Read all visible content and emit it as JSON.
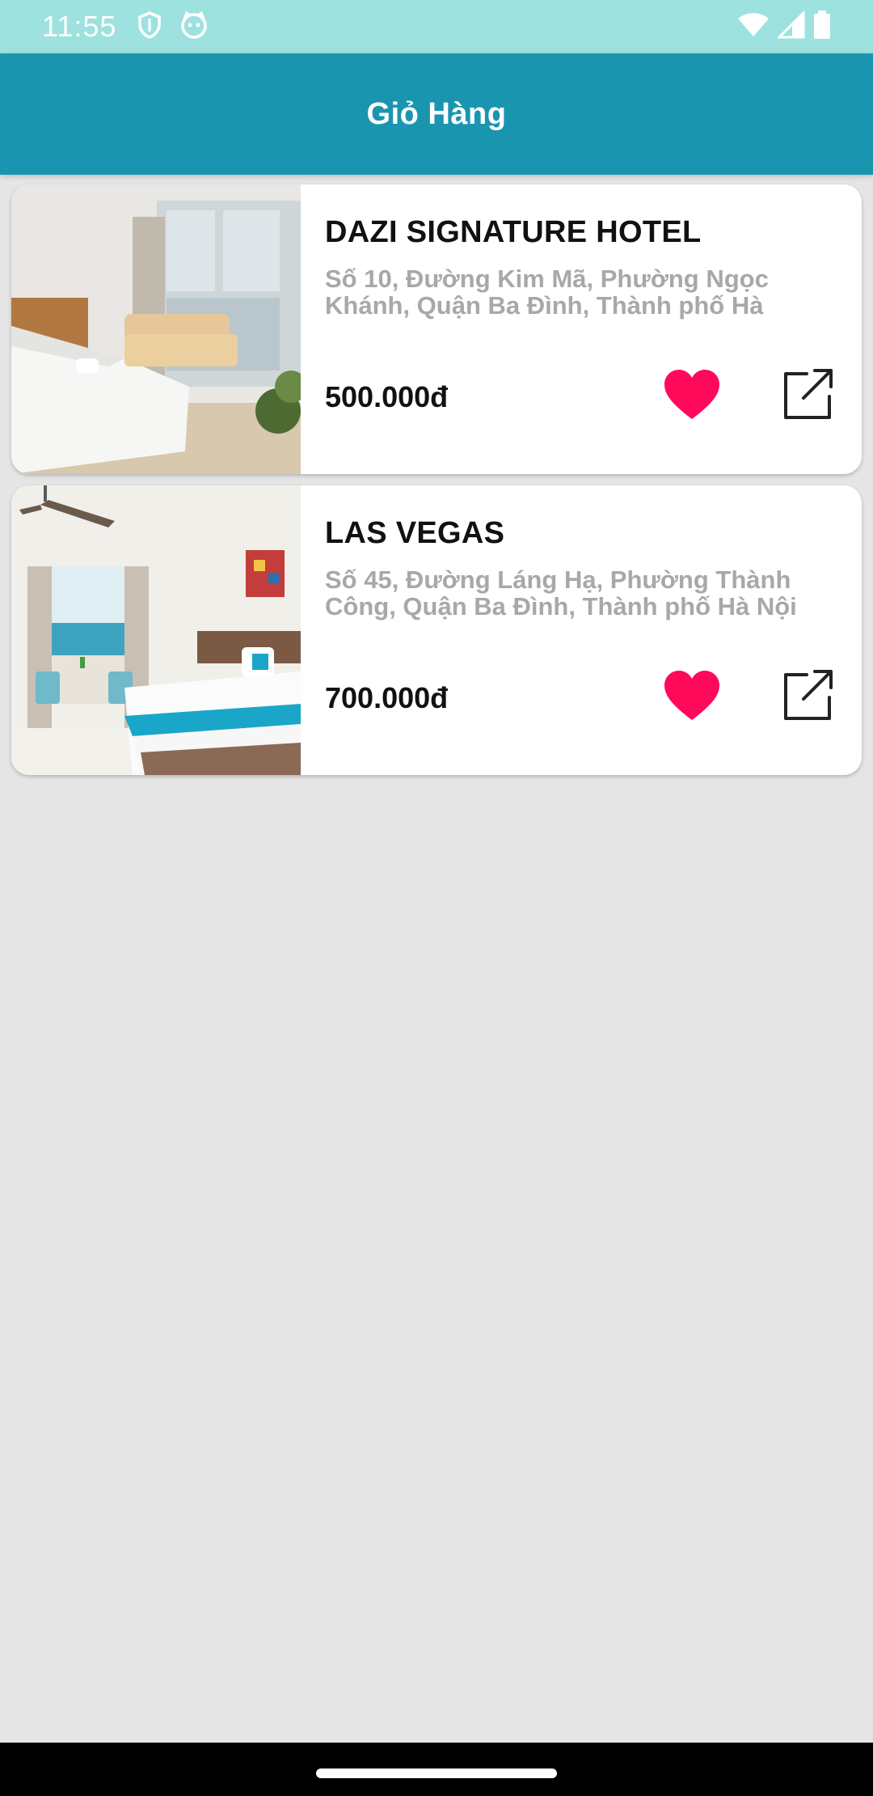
{
  "status_bar": {
    "time": "11:55",
    "icons": [
      "shield-icon",
      "cat-icon",
      "wifi-icon",
      "signal-icon",
      "battery-icon"
    ],
    "background": "#9de2df"
  },
  "app_bar": {
    "title": "Giỏ Hàng",
    "background": "#1a95af"
  },
  "cart_items": [
    {
      "name": "DAZI SIGNATURE HOTEL",
      "address": "Số 10, Đường Kim Mã, Phường Ngọc Khánh, Quận Ba Đình, Thành phố Hà",
      "price": "500.000đ",
      "favorite": true,
      "image": "hotel-room-photo"
    },
    {
      "name": "LAS VEGAS",
      "address": "Số 45, Đường Láng Hạ, Phường Thành Công, Quận Ba Đình, Thành phố Hà Nội",
      "price": "700.000đ",
      "favorite": true,
      "image": "hotel-room-photo"
    }
  ],
  "colors": {
    "heart": "#ff0a5a",
    "page_background": "#e5e5e5",
    "address_text": "#a8a8a8"
  }
}
